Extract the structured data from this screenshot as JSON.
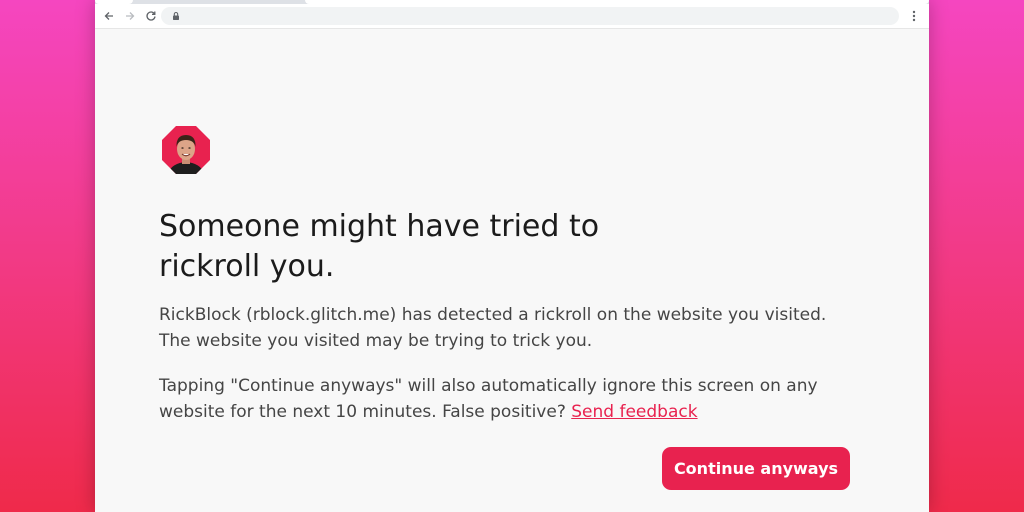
{
  "browser": {
    "back_icon": "arrow-left-icon",
    "forward_icon": "arrow-right-icon",
    "reload_icon": "reload-icon",
    "lock_icon": "lock-icon",
    "menu_icon": "kebab-menu-icon",
    "address": ""
  },
  "page": {
    "avatar_icon": "rick-octagon-avatar",
    "heading_line1": "Someone might have tried to",
    "heading_line2": "rickroll you.",
    "paragraph1": "RickBlock (rblock.glitch.me) has detected a rickroll on the website you visited. The website you visited may be trying to trick you.",
    "paragraph2": "Tapping \"Continue anyways\" will also automatically ignore this screen on any website for the next 10 minutes. False positive? ",
    "feedback_link": "Send feedback",
    "continue_button": "Continue anyways"
  },
  "colors": {
    "accent": "#e8224f",
    "background_top": "#f546c0",
    "background_bottom": "#ef2a4a",
    "page_background": "#f8f8f8"
  }
}
